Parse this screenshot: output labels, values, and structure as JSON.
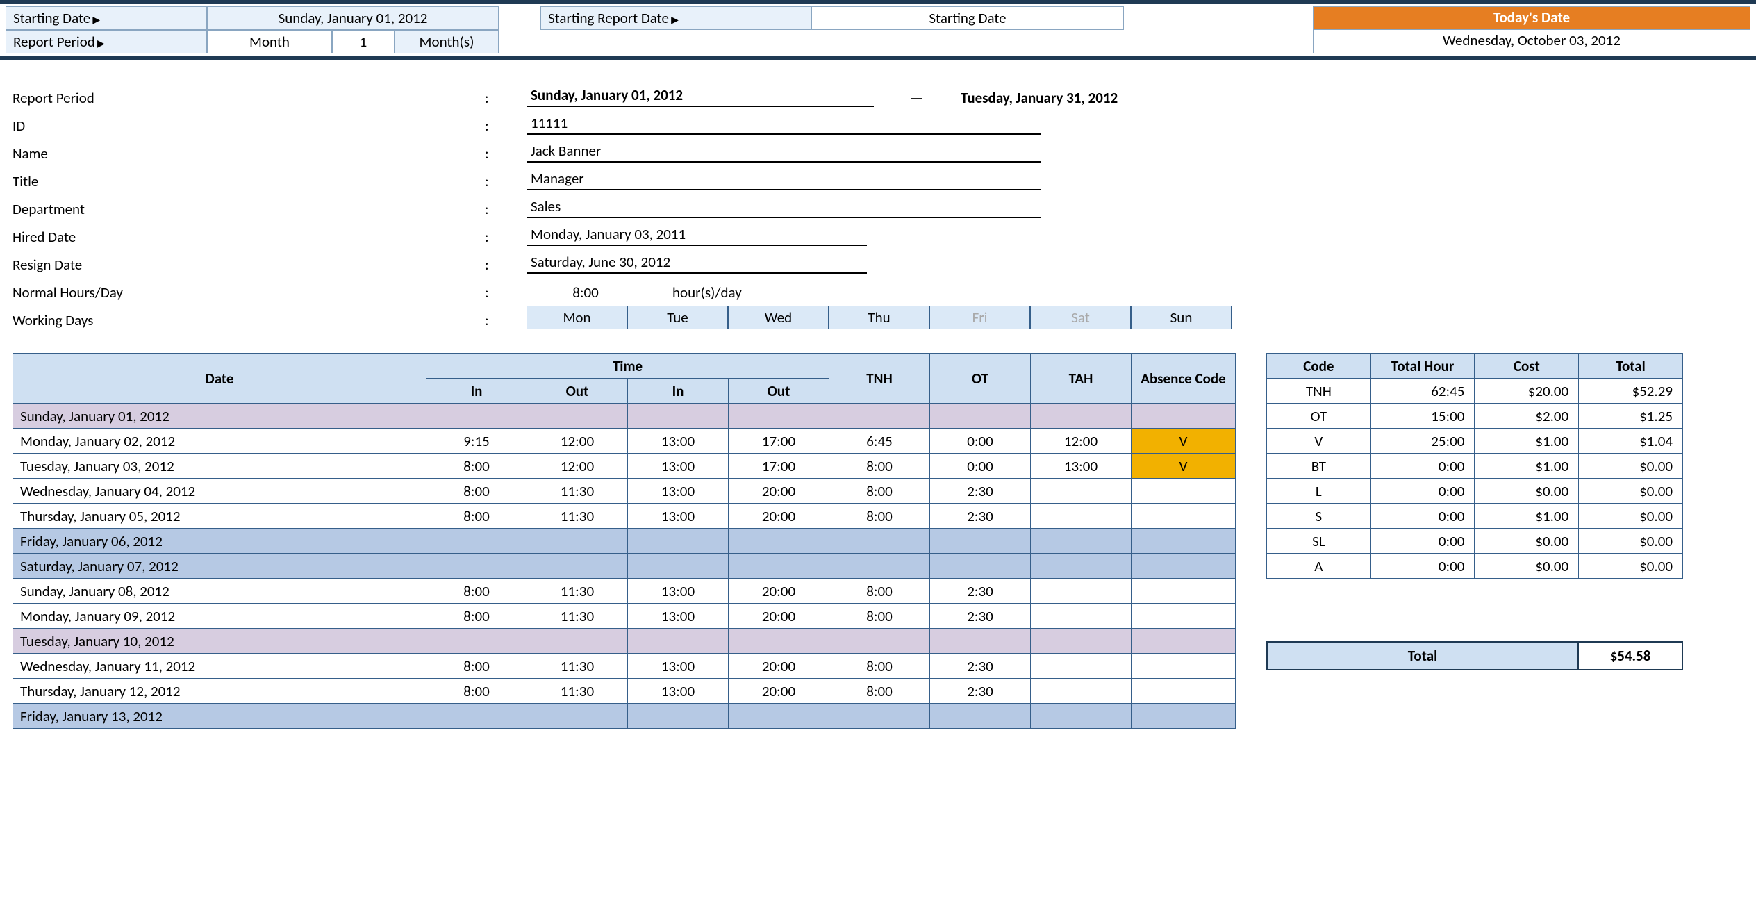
{
  "ribbon": {
    "starting_date_label": "Starting Date",
    "starting_date_value": "Sunday, January 01, 2012",
    "report_period_label": "Report Period",
    "report_period_unit": "Month",
    "report_period_num": "1",
    "report_period_suffix": "Month(s)",
    "starting_report_date_label": "Starting Report Date",
    "starting_report_date_value": "Starting Date",
    "today_label": "Today's Date",
    "today_value": "Wednesday, October 03, 2012"
  },
  "info": {
    "labels": {
      "report_period": "Report Period",
      "id": "ID",
      "name": "Name",
      "title": "Title",
      "department": "Department",
      "hired_date": "Hired Date",
      "resign_date": "Resign Date",
      "normal_hours": "Normal Hours/Day",
      "working_days": "Working Days"
    },
    "report_period_start": "Sunday, January 01, 2012",
    "report_period_dash": "—",
    "report_period_end": "Tuesday, January 31, 2012",
    "id": "11111",
    "name": "Jack Banner",
    "title": "Manager",
    "department": "Sales",
    "hired_date": "Monday, January 03, 2011",
    "resign_date": "Saturday, June 30, 2012",
    "normal_hours_val": "8:00",
    "normal_hours_unit": "hour(s)/day",
    "working_days": [
      {
        "d": "Mon",
        "on": true
      },
      {
        "d": "Tue",
        "on": true
      },
      {
        "d": "Wed",
        "on": true
      },
      {
        "d": "Thu",
        "on": true
      },
      {
        "d": "Fri",
        "on": false
      },
      {
        "d": "Sat",
        "on": false
      },
      {
        "d": "Sun",
        "on": true
      }
    ]
  },
  "timesheet": {
    "headers": {
      "date": "Date",
      "time": "Time",
      "in": "In",
      "out": "Out",
      "tnh": "TNH",
      "ot": "OT",
      "tah": "TAH",
      "abs": "Absence Code"
    },
    "rows": [
      {
        "date": "Sunday, January 01, 2012",
        "cls": "purple"
      },
      {
        "date": "Monday, January 02, 2012",
        "in1": "9:15",
        "out1": "12:00",
        "in2": "13:00",
        "out2": "17:00",
        "tnh": "6:45",
        "ot": "0:00",
        "tah": "12:00",
        "abs": "V"
      },
      {
        "date": "Tuesday, January 03, 2012",
        "in1": "8:00",
        "out1": "12:00",
        "in2": "13:00",
        "out2": "17:00",
        "tnh": "8:00",
        "ot": "0:00",
        "tah": "13:00",
        "abs": "V"
      },
      {
        "date": "Wednesday, January 04, 2012",
        "in1": "8:00",
        "out1": "11:30",
        "in2": "13:00",
        "out2": "20:00",
        "tnh": "8:00",
        "ot": "2:30"
      },
      {
        "date": "Thursday, January 05, 2012",
        "in1": "8:00",
        "out1": "11:30",
        "in2": "13:00",
        "out2": "20:00",
        "tnh": "8:00",
        "ot": "2:30"
      },
      {
        "date": "Friday, January 06, 2012",
        "cls": "blue"
      },
      {
        "date": "Saturday, January 07, 2012",
        "cls": "blue"
      },
      {
        "date": "Sunday, January 08, 2012",
        "in1": "8:00",
        "out1": "11:30",
        "in2": "13:00",
        "out2": "20:00",
        "tnh": "8:00",
        "ot": "2:30"
      },
      {
        "date": "Monday, January 09, 2012",
        "in1": "8:00",
        "out1": "11:30",
        "in2": "13:00",
        "out2": "20:00",
        "tnh": "8:00",
        "ot": "2:30"
      },
      {
        "date": "Tuesday, January 10, 2012",
        "cls": "purple"
      },
      {
        "date": "Wednesday, January 11, 2012",
        "in1": "8:00",
        "out1": "11:30",
        "in2": "13:00",
        "out2": "20:00",
        "tnh": "8:00",
        "ot": "2:30"
      },
      {
        "date": "Thursday, January 12, 2012",
        "in1": "8:00",
        "out1": "11:30",
        "in2": "13:00",
        "out2": "20:00",
        "tnh": "8:00",
        "ot": "2:30"
      },
      {
        "date": "Friday, January 13, 2012",
        "cls": "blue"
      }
    ]
  },
  "summary": {
    "headers": {
      "code": "Code",
      "total_hour": "Total Hour",
      "cost": "Cost",
      "total": "Total"
    },
    "rows": [
      {
        "code": "TNH",
        "hour": "62:45",
        "cost": "$20.00",
        "total": "$52.29"
      },
      {
        "code": "OT",
        "hour": "15:00",
        "cost": "$2.00",
        "total": "$1.25"
      },
      {
        "code": "V",
        "hour": "25:00",
        "cost": "$1.00",
        "total": "$1.04"
      },
      {
        "code": "BT",
        "hour": "0:00",
        "cost": "$1.00",
        "total": "$0.00"
      },
      {
        "code": "L",
        "hour": "0:00",
        "cost": "$0.00",
        "total": "$0.00"
      },
      {
        "code": "S",
        "hour": "0:00",
        "cost": "$1.00",
        "total": "$0.00"
      },
      {
        "code": "SL",
        "hour": "0:00",
        "cost": "$0.00",
        "total": "$0.00"
      },
      {
        "code": "A",
        "hour": "0:00",
        "cost": "$0.00",
        "total": "$0.00"
      }
    ],
    "grand_total_label": "Total",
    "grand_total_value": "$54.58"
  }
}
